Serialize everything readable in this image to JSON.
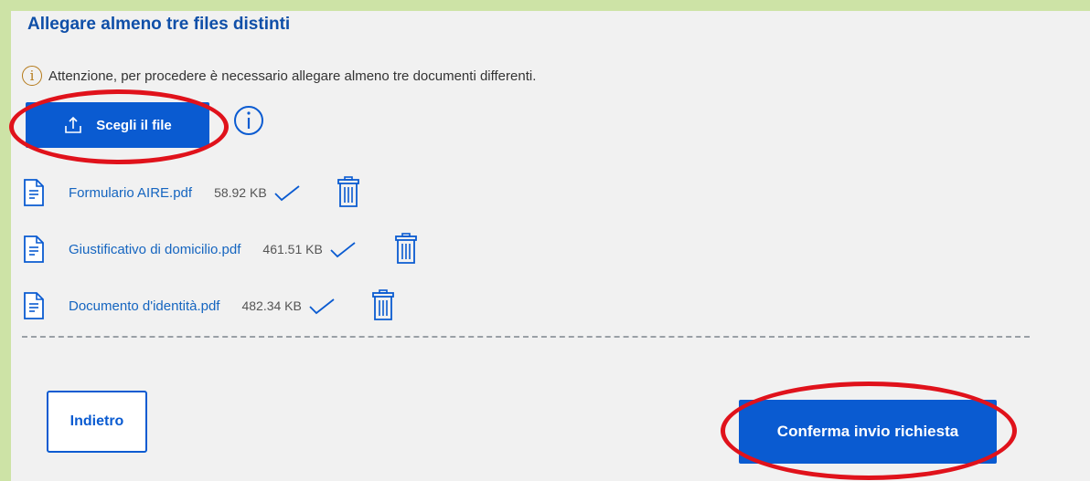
{
  "section": {
    "title": "Allegare almeno tre files distinti",
    "warning_text": "Attenzione, per procedere è necessario allegare almeno tre documenti differenti."
  },
  "actions": {
    "choose_file_label": "Scegli il file",
    "back_label": "Indietro",
    "confirm_label": "Conferma invio richiesta"
  },
  "files": [
    {
      "name": "Formulario AIRE.pdf",
      "size": "58.92 KB"
    },
    {
      "name": "Giustificativo di domicilio.pdf",
      "size": "461.51 KB"
    },
    {
      "name": "Documento d'identità.pdf",
      "size": "482.34 KB"
    }
  ],
  "colors": {
    "primary": "#0a5bd1",
    "title": "#0f4fa8",
    "link": "#1565c0",
    "highlight": "#e0121b",
    "warning": "#b57a1a",
    "outer_background": "#cde3a6",
    "panel_background": "#f1f1f1"
  },
  "icons": [
    "info-icon",
    "upload-icon",
    "file-document-icon",
    "check-icon",
    "trash-icon"
  ]
}
